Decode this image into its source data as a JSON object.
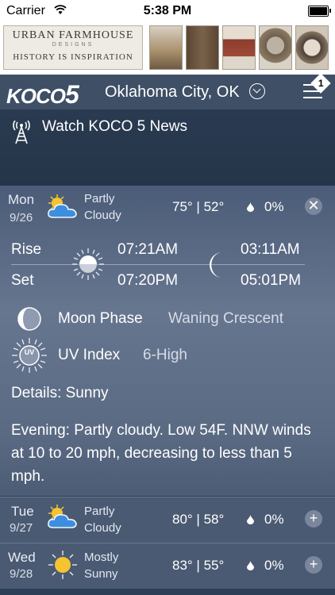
{
  "status_bar": {
    "carrier": "Carrier",
    "time": "5:38 PM"
  },
  "ad": {
    "brand_line1": "URBAN FARMHOUSE",
    "brand_line2": "DESIGNS",
    "tagline": "HISTORY IS INSPIRATION"
  },
  "header": {
    "logo": "KOCO",
    "logo_num": "5",
    "location": "Oklahoma City, OK",
    "notification_count": "1"
  },
  "watch": {
    "label": "Watch KOCO 5 News"
  },
  "today": {
    "day": "Mon",
    "date": "9/26",
    "condition_line1": "Partly",
    "condition_line2": "Cloudy",
    "temps": "75° | 52°",
    "precip": "0%",
    "rise_label": "Rise",
    "set_label": "Set",
    "sunrise": "07:21AM",
    "sunset": "07:20PM",
    "moonrise": "03:11AM",
    "moonset": "05:01PM",
    "moon_phase_label": "Moon Phase",
    "moon_phase_value": "Waning Crescent",
    "uv_label": "UV Index",
    "uv_value": "6-High",
    "uv_icon_text": "UV",
    "details": "Details: Sunny",
    "evening": "Evening: Partly cloudy. Low 54F. NNW winds at 10 to 20 mph, decreasing to less than 5 mph."
  },
  "forecast": [
    {
      "day": "Tue",
      "date": "9/27",
      "condition_line1": "Partly",
      "condition_line2": "Cloudy",
      "temps": "80° | 58°",
      "precip": "0%",
      "icon": "partly-cloudy"
    },
    {
      "day": "Wed",
      "date": "9/28",
      "condition_line1": "Mostly",
      "condition_line2": "Sunny",
      "temps": "83° | 55°",
      "precip": "0%",
      "icon": "sunny"
    }
  ],
  "colors": {
    "sun": "#f5c431",
    "cloud": "#3c8fe0",
    "header_bg": "#3e4f66"
  }
}
